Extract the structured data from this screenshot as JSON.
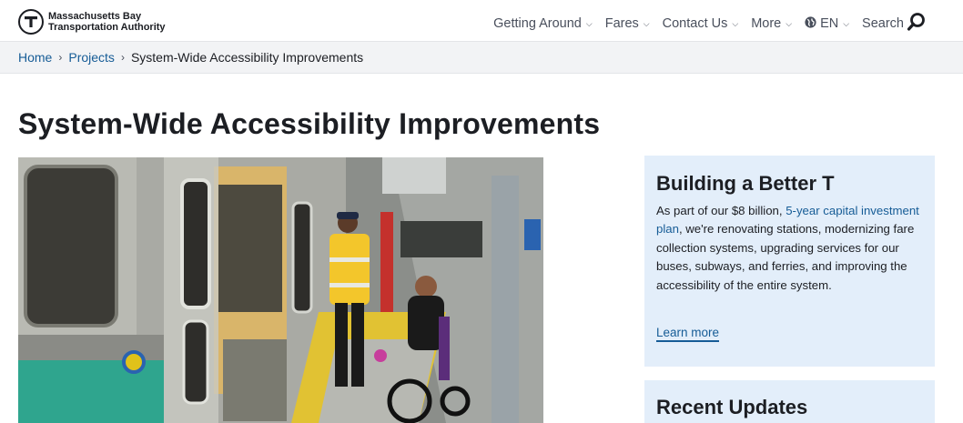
{
  "header": {
    "logo_line1": "Massachusetts Bay",
    "logo_line2": "Transportation Authority",
    "logo_icon": "mbta-t-logo",
    "nav": [
      {
        "label": "Getting Around"
      },
      {
        "label": "Fares"
      },
      {
        "label": "Contact Us"
      },
      {
        "label": "More"
      }
    ],
    "language": "EN",
    "language_icon": "globe-icon",
    "search_label": "Search",
    "search_icon": "search-icon"
  },
  "breadcrumb": {
    "items": [
      "Home",
      "Projects"
    ],
    "current": "System-Wide Accessibility Improvements"
  },
  "page": {
    "title": "System-Wide Accessibility Improvements",
    "hero_image": "photo of worker helping a wheelchair user board a subway train"
  },
  "sidebar": {
    "card1": {
      "title": "Building a Better T",
      "body_prefix": "As part of our $8 billion, ",
      "body_link": "5-year capital investment plan",
      "body_suffix": ", we're renovating stations, modernizing fare collection systems, upgrading services for our buses, subways, and ferries, and improving the accessibility of the entire system.",
      "learn_more": "Learn more"
    },
    "card2": {
      "title": "Recent Updates"
    }
  },
  "colors": {
    "link": "#165c96",
    "card_bg": "#e3eefa",
    "crumb_bg": "#f2f3f5",
    "text": "#1c1e23"
  }
}
